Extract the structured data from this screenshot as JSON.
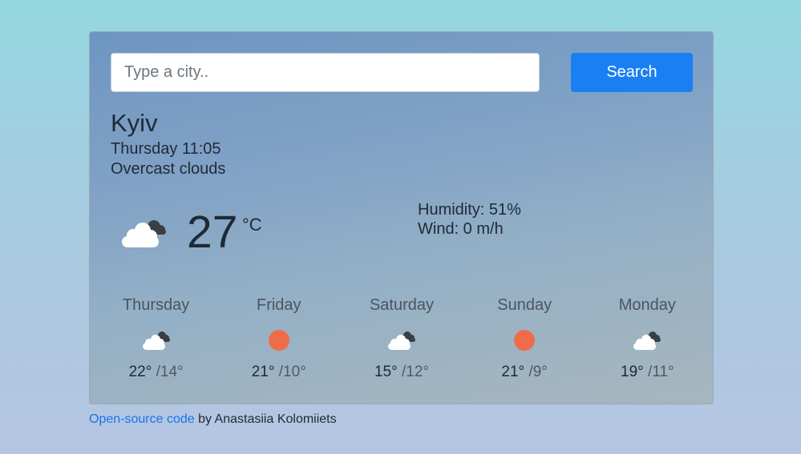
{
  "search": {
    "placeholder": "Type a city..",
    "button_label": "Search"
  },
  "current": {
    "city": "Kyiv",
    "datetime": "Thursday 11:05",
    "description": "Overcast clouds",
    "icon": "cloud-icon",
    "temperature": "27",
    "unit": "°C",
    "humidity": "Humidity: 51%",
    "wind": "Wind: 0 m/h"
  },
  "forecast": [
    {
      "day": "Thursday",
      "icon": "cloud-icon",
      "max": "22°",
      "min": "/14°"
    },
    {
      "day": "Friday",
      "icon": "sun-icon",
      "max": "21°",
      "min": "/10°"
    },
    {
      "day": "Saturday",
      "icon": "cloud-icon",
      "max": "15°",
      "min": "/12°"
    },
    {
      "day": "Sunday",
      "icon": "sun-icon",
      "max": "21°",
      "min": "/9°"
    },
    {
      "day": "Monday",
      "icon": "cloud-icon",
      "max": "19°",
      "min": "/11°"
    }
  ],
  "footer": {
    "link_text": "Open-source code",
    "author_text": " by Anastasiia Kolomiiets"
  },
  "colors": {
    "button": "#1a7ff2",
    "link": "#1a73e8",
    "sun": "#ef6c48"
  }
}
